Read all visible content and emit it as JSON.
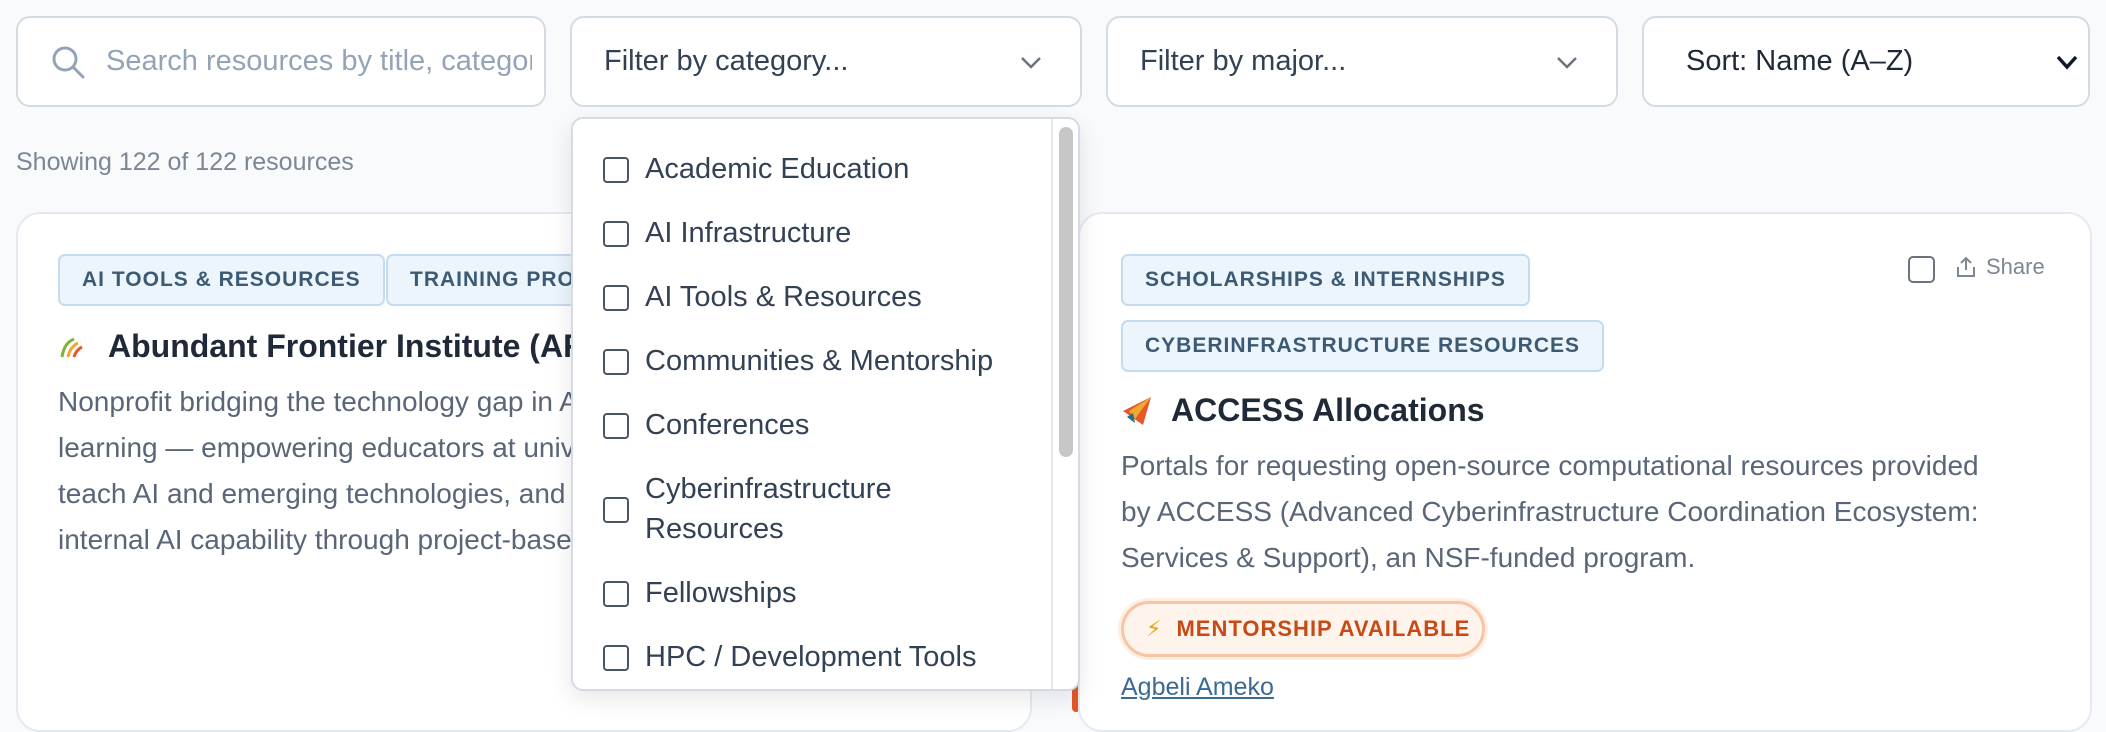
{
  "filters": {
    "search_placeholder": "Search resources by title, category...",
    "category_label": "Filter by category...",
    "major_label": "Filter by major...",
    "sort_label": "Sort: Name (A–Z)"
  },
  "results": {
    "count_text": "Showing 122 of 122 resources"
  },
  "category_options": [
    "Academic Education",
    "AI Infrastructure",
    "AI Tools & Resources",
    "Communities & Mentorship",
    "Conferences",
    "Cyberinfrastructure Resources",
    "Fellowships",
    "HPC / Development Tools"
  ],
  "cards": [
    {
      "tags": [
        "AI TOOLS & RESOURCES",
        "TRAINING PROGRAMS"
      ],
      "title": "Abundant Frontier Institute (AFI)",
      "description_lines": [
        "Nonprofit bridging the technology gap in AI",
        "learning — empowering educators at universities to",
        "teach AI and emerging technologies, and building",
        "internal AI capability through project-based work."
      ]
    },
    {
      "tags": [
        "SCHOLARSHIPS & INTERNSHIPS",
        "CYBERINFRASTRUCTURE RESOURCES"
      ],
      "title": "ACCESS Allocations",
      "description_lines": [
        "Portals for requesting open-source computational resources provided",
        "by ACCESS (Advanced Cyberinfrastructure Coordination Ecosystem:",
        "Services & Support), an NSF-funded program."
      ],
      "share_label": "Share",
      "mentorship_badge": "MENTORSHIP AVAILABLE",
      "mentor_name": "Agbeli Ameko"
    }
  ],
  "colors": {
    "accent": "#e4582a",
    "tag_bg": "#edf5fc",
    "tag_text": "#3d5a75",
    "mentor_text": "#c74a16"
  },
  "icons": [
    "search-icon",
    "chevron-down-icon",
    "share-icon",
    "bolt-icon",
    "logo-icon"
  ]
}
